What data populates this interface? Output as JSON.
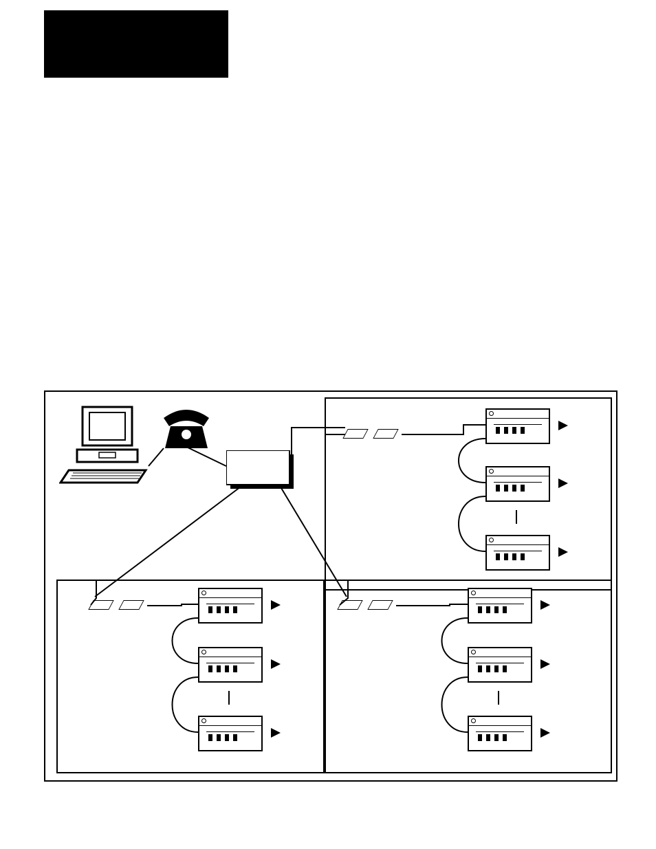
{
  "header": {
    "black_box_label": ""
  },
  "diagram": {
    "sub_frames": [
      "top",
      "left",
      "right"
    ],
    "icons": {
      "computer": "computer-icon",
      "telephone": "telephone-icon",
      "hub": "hub-icon",
      "modem": "modem-icon",
      "device": "device-icon",
      "arrow": "arrow-right-icon"
    },
    "device_label_placeholder": ""
  }
}
